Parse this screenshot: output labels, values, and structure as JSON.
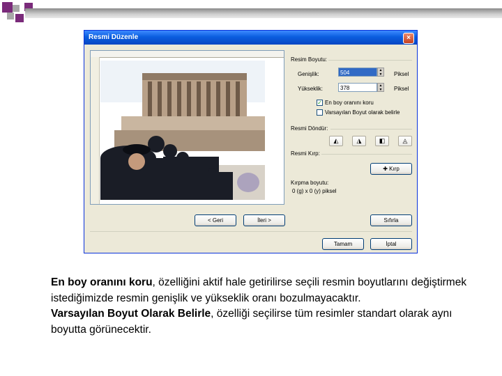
{
  "dialog": {
    "title": "Resmi Düzenle",
    "close_label": "×",
    "size_group": "Resim Boyutu:",
    "width_label": "Genişlik:",
    "width_value": "504",
    "width_unit": "Piksel",
    "height_label": "Yükseklik:",
    "height_value": "378",
    "height_unit": "Piksel",
    "keep_ratio_label": "En boy oranını koru",
    "default_size_label": "Varsayılan Boyut olarak belirle",
    "rotate_group": "Resmi Döndür:",
    "rotate_buttons": [
      "◭",
      "◮",
      "◧",
      "◬"
    ],
    "crop_group": "Resmi Kırp:",
    "crop_button": "Kırp",
    "crop_size_label": "Kırpma boyutu:",
    "crop_size_value": "0 (g) x 0 (y) piksel",
    "back_button": "< Geri",
    "next_button": "İleri >",
    "reset_button": "Sıfırla",
    "ok_button": "Tamam",
    "cancel_button": "İptal"
  },
  "caption": {
    "p1_bold": "En boy oranını koru",
    "p1_rest": ", özelliğini aktif hale getirilirse seçili resmin boyutlarını değiştirmek istediğimizde resmin genişlik ve yükseklik oranı bozulmayacaktır.",
    "p2_bold": "Varsayılan Boyut Olarak Belirle",
    "p2_rest": ", özelliği seçilirse tüm resimler standart olarak aynı boyutta görünecektir."
  },
  "colors": {
    "titlebar": "#0a5ddf",
    "deco_purple": "#7a2a7a",
    "deco_gray": "#9a9a9a"
  }
}
